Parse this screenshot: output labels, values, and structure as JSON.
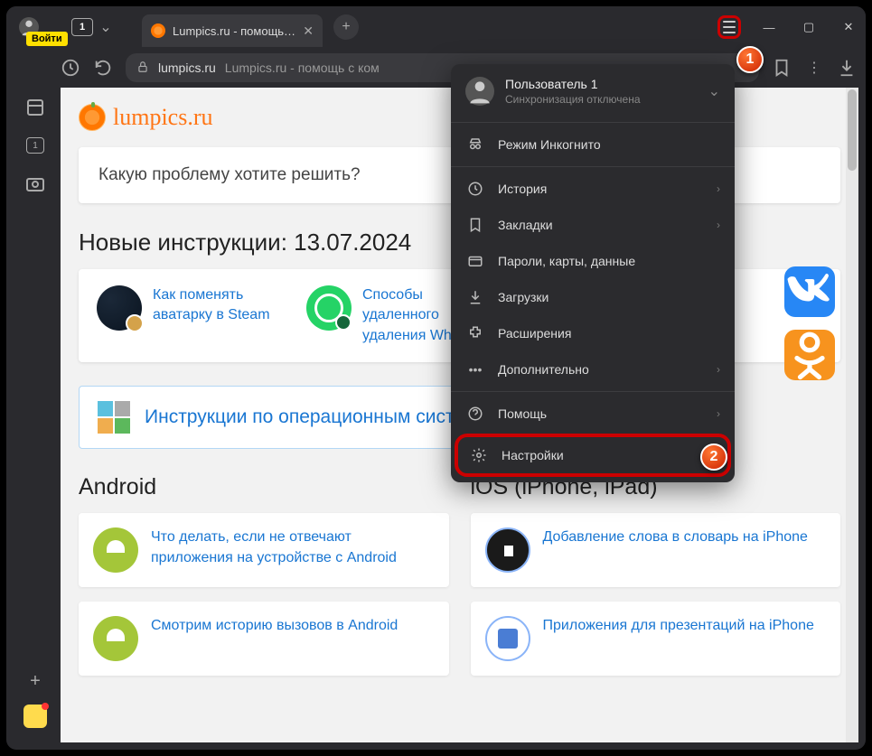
{
  "titlebar": {
    "login": "Войти",
    "tab_count": "1",
    "tab_title": "Lumpics.ru - помощь с к",
    "new_tab": "+"
  },
  "address": {
    "domain": "lumpics.ru",
    "page_title": "Lumpics.ru - помощь с ком"
  },
  "page": {
    "logo": "lumpics.ru",
    "search_placeholder": "Какую проблему хотите решить?",
    "new_instructions_heading": "Новые инструкции: 13.07.2024",
    "instr1": "Как поменять аватарку в Steam",
    "instr2": "Способы удаленного удаления WhatsApp",
    "os_heading": "Инструкции по операционным системам",
    "android_heading": "Android",
    "ios_heading": "iOS (iPhone, iPad)",
    "android_art1": "Что делать, если не отвечают приложения на устройстве с Android",
    "android_art2": "Смотрим историю вызовов в Android",
    "ios_art1": "Добавление слова в словарь на iPhone",
    "ios_art2": "Приложения для презентаций на iPhone"
  },
  "menu": {
    "user_name": "Пользователь 1",
    "user_sub": "Синхронизация отключена",
    "incognito": "Режим Инкогнито",
    "history": "История",
    "bookmarks": "Закладки",
    "passwords": "Пароли, карты, данные",
    "downloads": "Загрузки",
    "extensions": "Расширения",
    "more": "Дополнительно",
    "help": "Помощь",
    "settings": "Настройки"
  },
  "callouts": {
    "one": "1",
    "two": "2"
  },
  "social": {
    "vk": "К",
    "ok": "✽"
  }
}
